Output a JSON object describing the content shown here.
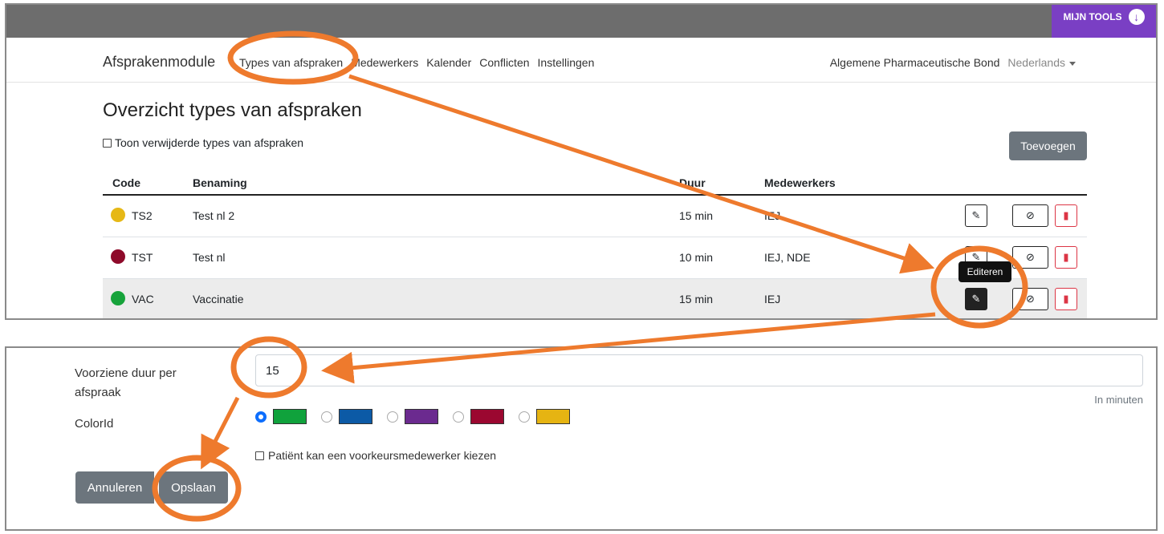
{
  "tools_button": {
    "label": "MIJN TOOLS"
  },
  "navbar": {
    "brand": "Afsprakenmodule",
    "links": [
      "Types van afspraken",
      "Medewerkers",
      "Kalender",
      "Conflicten",
      "Instellingen"
    ],
    "organization": "Algemene Pharmaceutische Bond",
    "language": "Nederlands"
  },
  "page": {
    "title": "Overzicht types van afspraken",
    "show_deleted_label": "Toon verwijderde types van afspraken",
    "add_button": "Toevoegen"
  },
  "table": {
    "headers": {
      "code": "Code",
      "name": "Benaming",
      "duration": "Duur",
      "staff": "Medewerkers"
    },
    "rows": [
      {
        "code": "TS2",
        "name": "Test nl 2",
        "duration": "15 min",
        "staff": "IEJ",
        "color": "#e6b816"
      },
      {
        "code": "TST",
        "name": "Test nl",
        "duration": "10 min",
        "staff": "IEJ, NDE",
        "color": "#8e0a2a"
      },
      {
        "code": "VAC",
        "name": "Vaccinatie",
        "duration": "15 min",
        "staff": "IEJ",
        "color": "#17a33b"
      }
    ]
  },
  "tooltip": "Editeren",
  "form": {
    "duration_label": "Voorziene duur per afspraak",
    "duration_value": "15",
    "duration_hint": "In minuten",
    "color_label": "ColorId",
    "color_options": [
      "#10a23c",
      "#0c5aa6",
      "#6b2a8f",
      "#9b0730",
      "#e6b412"
    ],
    "selected_color_index": 0,
    "preferred_staff_label": "Patiënt kan een voorkeursmedewerker kiezen",
    "cancel_button": "Annuleren",
    "save_button": "Opslaan"
  },
  "annotation_color": "#ee7a2d"
}
